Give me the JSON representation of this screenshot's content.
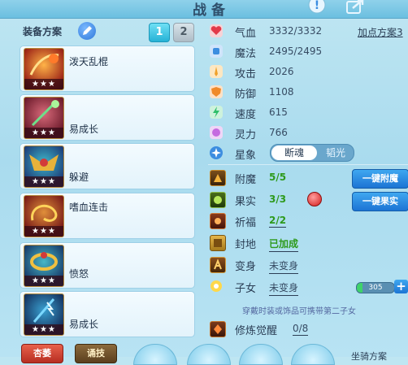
{
  "window": {
    "title": "战备"
  },
  "colors": {
    "accent": "#26b2d6",
    "button_blue": "#1c74d4",
    "green_text": "#2e9a1c"
  },
  "equipment": {
    "label": "装备方案",
    "pages": [
      "1",
      "2"
    ],
    "active_page": "1",
    "items": [
      {
        "name": "泼天乱棍",
        "stars": "★★★",
        "icon": "staff-swirl-icon"
      },
      {
        "name": "易成长",
        "stars": "★★★",
        "icon": "green-staff-icon"
      },
      {
        "name": "躲避",
        "stars": "★★★",
        "icon": "winged-mask-icon"
      },
      {
        "name": "嗜血连击",
        "stars": "★★★",
        "icon": "fire-tail-icon"
      },
      {
        "name": "愤怒",
        "stars": "★★★",
        "icon": "ring-icon"
      },
      {
        "name": "易成长",
        "stars": "★★★",
        "icon": "lightning-staff-icon"
      }
    ]
  },
  "stats": {
    "plan_link": "加点方案3",
    "rows": [
      {
        "label": "气血",
        "value": "3332/3332",
        "icon": "heart-icon",
        "color": "#e23a4a"
      },
      {
        "label": "魔法",
        "value": "2495/2495",
        "icon": "mana-icon",
        "color": "#3c8de0"
      },
      {
        "label": "攻击",
        "value": "2026",
        "icon": "sword-icon",
        "color": "#f0a12a"
      },
      {
        "label": "防御",
        "value": "1108",
        "icon": "shield-icon",
        "color": "#f08a2a"
      },
      {
        "label": "速度",
        "value": "615",
        "icon": "lightning-icon",
        "color": "#2fbf6a"
      },
      {
        "label": "灵力",
        "value": "766",
        "icon": "spirit-icon",
        "color": "#c56be0"
      }
    ]
  },
  "xingxiang": {
    "label": "星象",
    "options": [
      "断魂",
      "韬光"
    ],
    "selected": "断魂"
  },
  "enhance": {
    "rows": [
      {
        "label": "附魔",
        "value": "5/5",
        "icon": "enchant-icon",
        "button": "一键附魔"
      },
      {
        "label": "果实",
        "value": "3/3",
        "icon": "fruit-icon",
        "button": "一键果实"
      },
      {
        "label": "祈福",
        "value": "2/2",
        "icon": "blessing-icon"
      },
      {
        "label": "封地",
        "value": "已加成",
        "icon": "fief-icon"
      },
      {
        "label": "变身",
        "value": "未变身",
        "icon": "transform-icon"
      },
      {
        "label": "子女",
        "value": "未变身",
        "icon": "child-icon"
      },
      {
        "label": "修炼觉醒",
        "value": "0/8",
        "icon": "cultivation-icon"
      }
    ],
    "child_progress": {
      "value": "305",
      "fraction": 0.15
    },
    "hint": "穿戴时装或饰品可携带第二子女"
  },
  "bottom": {
    "tabs": [
      "杏萎",
      "诵技"
    ],
    "follow_plan": "坐骑方案"
  }
}
